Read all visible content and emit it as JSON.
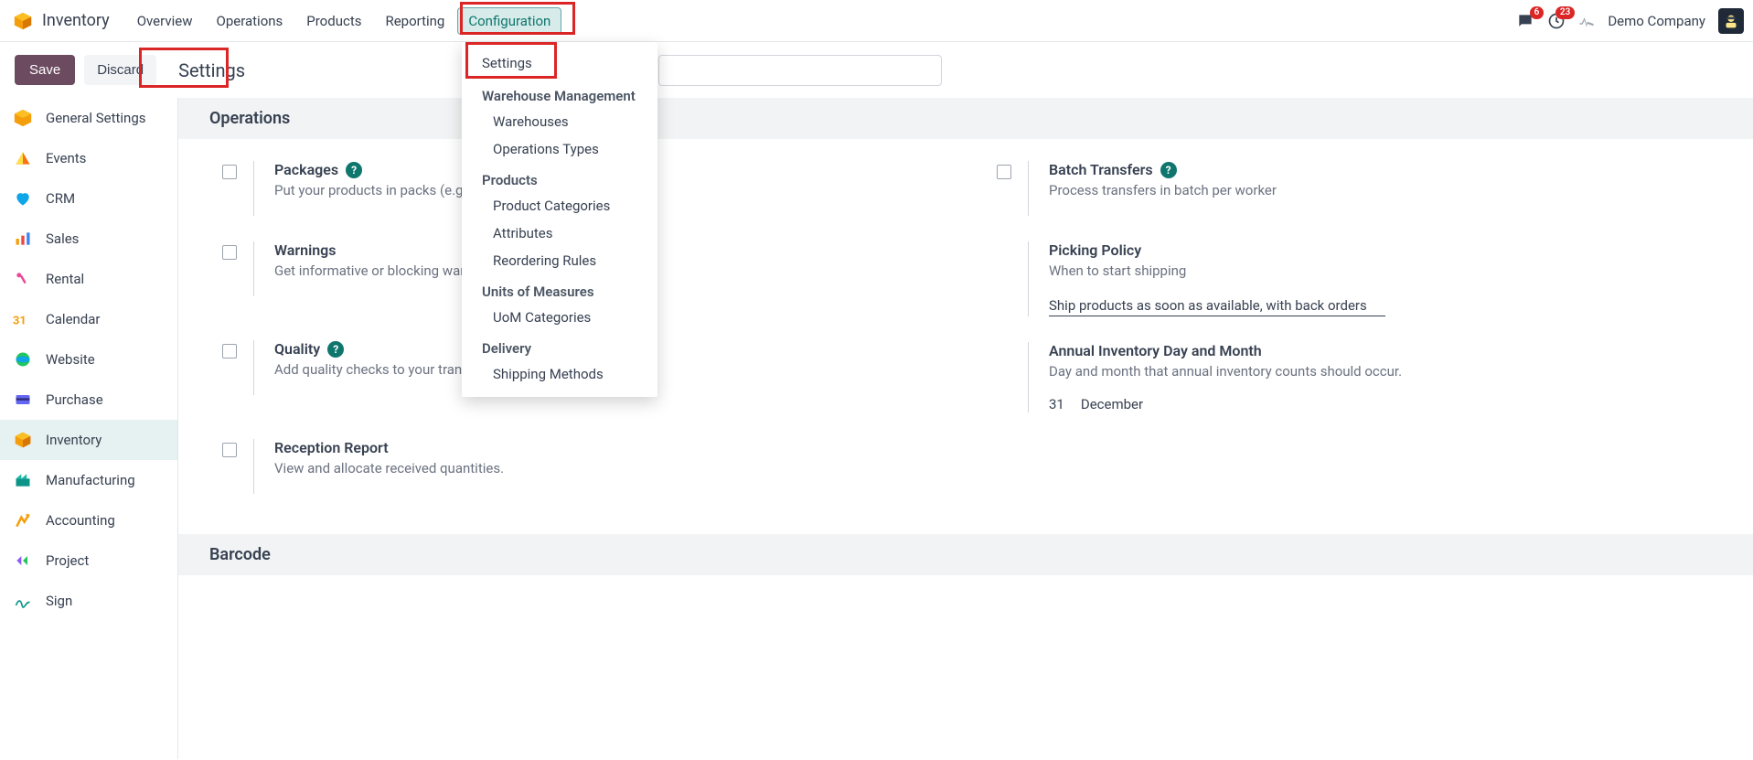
{
  "app": {
    "title": "Inventory"
  },
  "nav": {
    "items": [
      "Overview",
      "Operations",
      "Products",
      "Reporting",
      "Configuration"
    ],
    "active_index": 4
  },
  "nav_right": {
    "msg_count": "6",
    "activity_count": "23",
    "company": "Demo Company"
  },
  "cp": {
    "save": "Save",
    "discard": "Discard",
    "title": "Settings",
    "search_placeholder": ""
  },
  "dropdown": {
    "top_item": "Settings",
    "groups": [
      {
        "label": "Warehouse Management",
        "items": [
          "Warehouses",
          "Operations Types"
        ]
      },
      {
        "label": "Products",
        "items": [
          "Product Categories",
          "Attributes",
          "Reordering Rules"
        ]
      },
      {
        "label": "Units of Measures",
        "items": [
          "UoM Categories"
        ]
      },
      {
        "label": "Delivery",
        "items": [
          "Shipping Methods"
        ]
      }
    ]
  },
  "sidebar": {
    "items": [
      {
        "label": "General Settings"
      },
      {
        "label": "Events"
      },
      {
        "label": "CRM"
      },
      {
        "label": "Sales"
      },
      {
        "label": "Rental"
      },
      {
        "label": "Calendar"
      },
      {
        "label": "Website"
      },
      {
        "label": "Purchase"
      },
      {
        "label": "Inventory"
      },
      {
        "label": "Manufacturing"
      },
      {
        "label": "Accounting"
      },
      {
        "label": "Project"
      },
      {
        "label": "Sign"
      }
    ],
    "active_index": 8
  },
  "sections": {
    "operations": {
      "title": "Operations",
      "left": [
        {
          "title": "Packages",
          "help": true,
          "desc": "Put your products in packs (e.g. parcels, boxes) and track them"
        },
        {
          "title": "Warnings",
          "help": false,
          "desc": "Get informative or blocking warnings on partners"
        },
        {
          "title": "Quality",
          "help": true,
          "desc": "Add quality checks to your transfer operations"
        },
        {
          "title": "Reception Report",
          "help": false,
          "desc": "View and allocate received quantities."
        }
      ],
      "right": {
        "batch": {
          "title": "Batch Transfers",
          "desc": "Process transfers in batch per worker"
        },
        "picking": {
          "title": "Picking Policy",
          "desc": "When to start shipping",
          "value": "Ship products as soon as available, with back orders"
        },
        "annual": {
          "title": "Annual Inventory Day and Month",
          "desc": "Day and month that annual inventory counts should occur.",
          "day": "31",
          "month": "December"
        }
      }
    },
    "barcode": {
      "title": "Barcode"
    }
  }
}
